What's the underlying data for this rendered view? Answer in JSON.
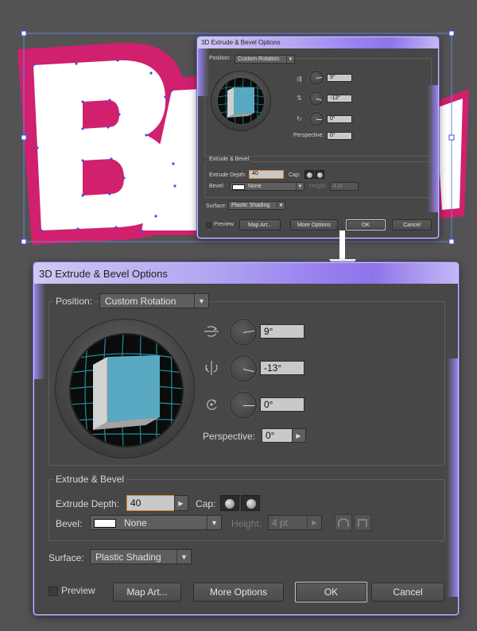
{
  "artwork_text": "BAM",
  "colors": {
    "canvas": "#535353",
    "dialog_bg": "#474747",
    "accent_purple": "#9a83ef",
    "art_pink": "#d0206e",
    "cube_face": "#5aa9c3",
    "grid_cyan": "#1f8f9a"
  },
  "dialog": {
    "title": "3D Extrude & Bevel Options",
    "position_label": "Position:",
    "position_value": "Custom Rotation",
    "rotation": [
      {
        "axis": "x",
        "icon": "x-axis-rotate-icon",
        "value": "9°",
        "angle_deg": 9
      },
      {
        "axis": "y",
        "icon": "y-axis-rotate-icon",
        "value": "-13°",
        "angle_deg": -13
      },
      {
        "axis": "z",
        "icon": "z-axis-rotate-icon",
        "value": "0°",
        "angle_deg": 0
      }
    ],
    "perspective_label": "Perspective:",
    "perspective_value": "0°",
    "extrude_section_label": "Extrude & Bevel",
    "extrude_depth_label": "Extrude Depth:",
    "extrude_depth_value": "40",
    "cap_label": "Cap:",
    "bevel_label": "Bevel:",
    "bevel_value": "None",
    "height_label": "Height:",
    "height_value": "4 pt",
    "surface_label": "Surface:",
    "surface_value": "Plastic Shading",
    "preview_label": "Preview",
    "map_art_label": "Map Art...",
    "more_options_label": "More Options",
    "ok_label": "OK",
    "cancel_label": "Cancel"
  }
}
